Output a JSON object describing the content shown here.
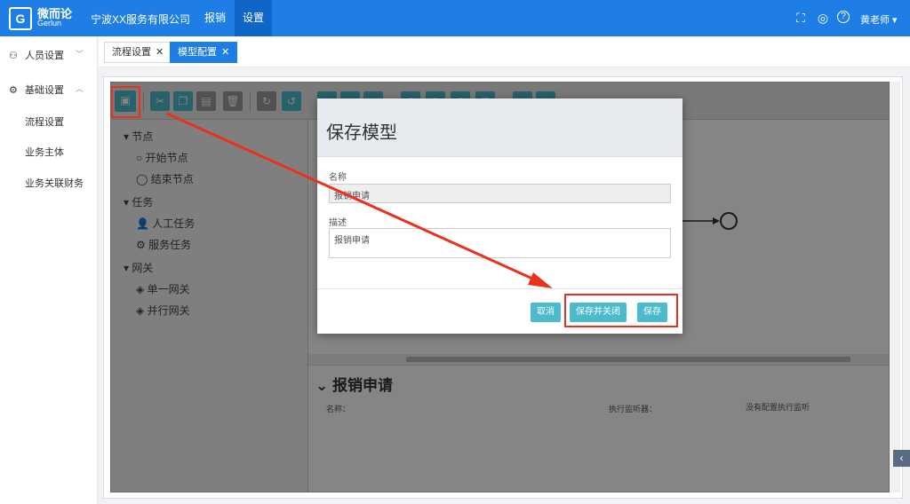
{
  "header": {
    "logo_cn": "微而论",
    "logo_en": "Gerlun",
    "company": "宁波XX服务有限公司",
    "nav": [
      "报销",
      "设置"
    ],
    "user": "黄老师 ▾"
  },
  "sidebar": {
    "groups": [
      {
        "label": "人员设置"
      },
      {
        "label": "基础设置"
      }
    ],
    "subitems": [
      "流程设置",
      "业务主体",
      "业务关联财务"
    ]
  },
  "tabs": [
    {
      "label": "流程设置",
      "active": false
    },
    {
      "label": "模型配置",
      "active": true
    }
  ],
  "palette": {
    "groups": [
      {
        "label": "节点",
        "items": [
          "开始节点",
          "结束节点"
        ]
      },
      {
        "label": "任务",
        "items": [
          "人工任务",
          "服务任务"
        ]
      },
      {
        "label": "网关",
        "items": [
          "单一网关",
          "并行网关"
        ]
      }
    ]
  },
  "properties": {
    "title": "报销申请",
    "name_label": "名称：",
    "listener_label": "执行监听器：",
    "listener_value": "没有配置执行监听"
  },
  "modal": {
    "title": "保存模型",
    "name_label": "名称",
    "name_value": "报销申请",
    "desc_label": "描述",
    "desc_value": "报销申请",
    "buttons": {
      "cancel": "取消",
      "save_close": "保存并关闭",
      "save": "保存"
    }
  },
  "colors": {
    "primary": "#1e7ee6",
    "toolbar_btn": "#4bbacc",
    "highlight": "#e8321e"
  }
}
